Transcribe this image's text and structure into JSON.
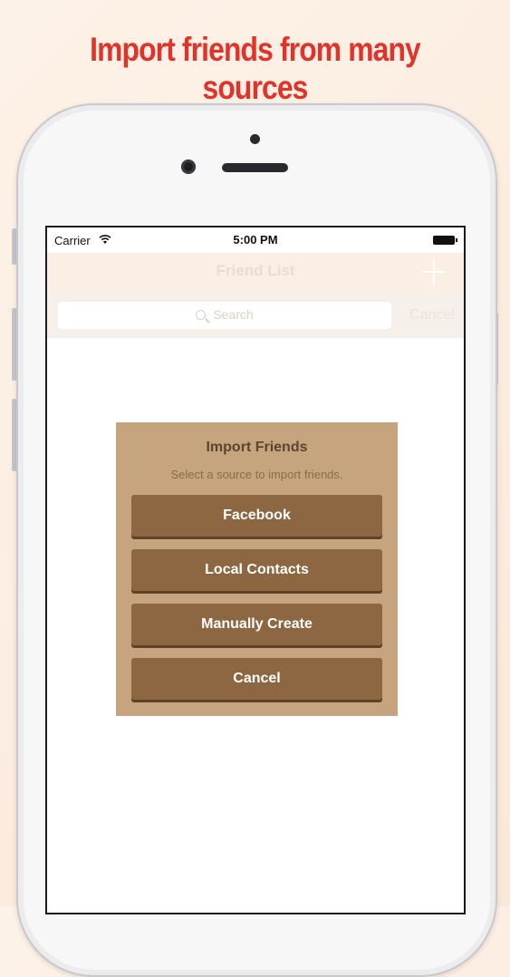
{
  "headline": "Import friends from many sources",
  "status_bar": {
    "carrier": "Carrier",
    "time": "5:00 PM",
    "icons": [
      "wifi-icon",
      "battery-icon"
    ]
  },
  "nav_bar": {
    "title": "Friend List",
    "add_icon": "plus-icon"
  },
  "search": {
    "placeholder": "Search",
    "cancel_label": "Cancel",
    "icon": "search-icon"
  },
  "dialog": {
    "title": "Import Friends",
    "message": "Select a source to import friends.",
    "buttons": [
      {
        "label": "Facebook"
      },
      {
        "label": "Local Contacts"
      },
      {
        "label": "Manually Create"
      },
      {
        "label": "Cancel"
      }
    ]
  },
  "colors": {
    "headline": "#e2332b",
    "dialog_background": "#c5a47e",
    "button_background": "#8d6741",
    "nav_background": "#fbeee4"
  }
}
